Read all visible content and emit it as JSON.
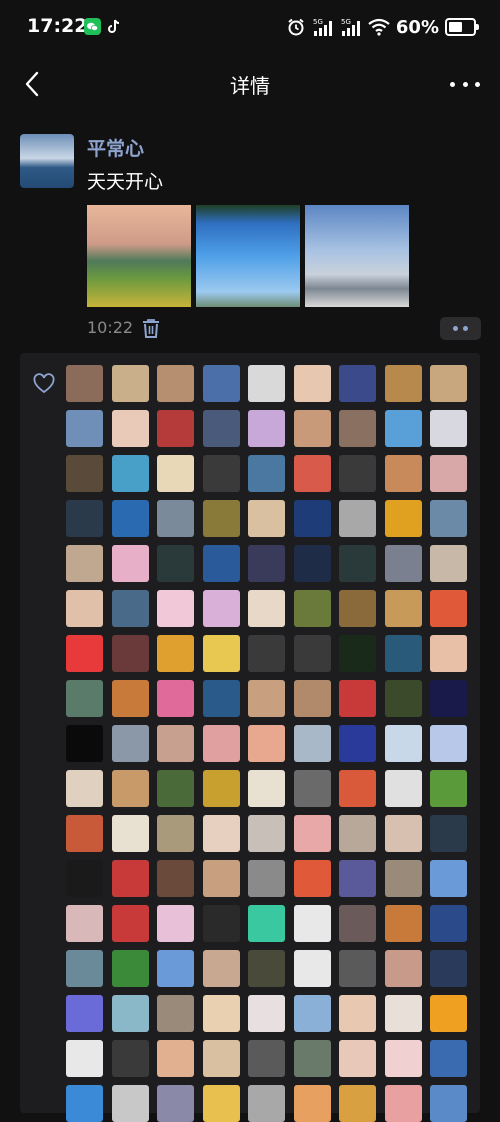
{
  "status_bar": {
    "time": "17:22",
    "battery": "60%",
    "battery_level": 0.6,
    "icons": [
      "wechat-icon",
      "tiktok-icon",
      "alarm-icon",
      "signal-5g-icon",
      "signal-5g-icon",
      "wifi-icon",
      "battery-icon"
    ]
  },
  "nav": {
    "title": "详情"
  },
  "post": {
    "author": "平常心",
    "text": "天天开心",
    "time": "10:22",
    "photos": [
      "flower-field-mountain-photo",
      "wind-turbine-sky-photo",
      "city-buildings-sky-photo"
    ]
  },
  "likes": {
    "icon": "heart-outline-icon",
    "avatar_colors": [
      "#8b6b5a",
      "#c9b08a",
      "#b58f6f",
      "#4b6fa8",
      "#d9d9d9",
      "#e7c7b0",
      "#3b4a8a",
      "#b8894d",
      "#c9a77e",
      "#6f8fb8",
      "#e9c9b7",
      "#b53a3a",
      "#4a5a7a",
      "#c8a8d8",
      "#c99a7a",
      "#8a7060",
      "#5aa0d8",
      "#d8d8e0",
      "#5a4a3a",
      "#48a0c8",
      "#e8d8b8",
      "#3a3a3a",
      "#4a78a0",
      "#d85a4a",
      "#3a3a3a",
      "#c88a5a",
      "#d8a8a8",
      "#2a3a4a",
      "#2a6ab0",
      "#7a8a9a",
      "#8a7a3a",
      "#d8c0a0",
      "#1e3c78",
      "#a8a8a8",
      "#e0a020",
      "#6a8aa8",
      "#c0a890",
      "#e8b0c8",
      "#2a3a3a",
      "#2a5a9a",
      "#3a3a5a",
      "#1e2c48",
      "#2a3a3a",
      "#7a8090",
      "#c8b8a8",
      "#e0c0a8",
      "#4a6a8a",
      "#f0c8d8",
      "#d8b0d8",
      "#e8d8c8",
      "#6a7a3a",
      "#8a6a3a",
      "#c89a5a",
      "#e05a3a",
      "#e83a3a",
      "#6a3a3a",
      "#e0a030",
      "#e8c850",
      "#3a3a3a",
      "#3a3a3a",
      "#1a2a1a",
      "#2a5a7a",
      "#e8c0a8",
      "#5a7a6a",
      "#c87a3a",
      "#e06a9a",
      "#2a5a8a",
      "#c8a080",
      "#b08a6a",
      "#c83a3a",
      "#3a4a2a",
      "#1a1a4a",
      "#0a0a0a",
      "#8a98a8",
      "#c8a090",
      "#e0a0a0",
      "#e8a890",
      "#a8b8c8",
      "#2a3a9a",
      "#c8d8e8",
      "#b8c8e8",
      "#e0d0c0",
      "#c89a6a",
      "#4a6a3a",
      "#c8a030",
      "#e8e0d0",
      "#6a6a6a",
      "#d85a3a",
      "#e0e0e0",
      "#5a9a3a",
      "#c85a3a",
      "#e8e0d0",
      "#a89a7a",
      "#e8d0c0",
      "#c8c0b8",
      "#e8a8a8",
      "#b8a89a",
      "#d8c0b0",
      "#2a3a4a",
      "#1a1a1a",
      "#c83a3a",
      "#6a4a3a",
      "#c8a080",
      "#8a8a8a",
      "#e05a3a",
      "#5a5a9a",
      "#9a8a7a",
      "#6a9ad8",
      "#d8b8b8",
      "#c83a3a",
      "#e8c0d8",
      "#2a2a2a",
      "#3ac8a0",
      "#e8e8e8",
      "#6a5a5a",
      "#c87a3a",
      "#2a4a8a",
      "#6a8a9a",
      "#3a8a3a",
      "#6a9ad8",
      "#c8a890",
      "#4a4a3a",
      "#e8e8e8",
      "#5a5a5a",
      "#c89a8a",
      "#2a3a5a",
      "#6a6ad8",
      "#8ab8c8",
      "#9a8a7a",
      "#e8d0b0",
      "#e8e0e0",
      "#8ab0d8",
      "#e8c8b0",
      "#e8e0d8",
      "#f0a020",
      "#e8e8e8",
      "#3a3a3a",
      "#e0b090",
      "#d8c0a0",
      "#5a5a5a",
      "#6a7a6a",
      "#e8c8b8",
      "#f0d0d0",
      "#3a6ab0",
      "#3a8ad8",
      "#c8c8c8",
      "#8a8aa8",
      "#e8c050",
      "#a8a8a8",
      "#e8a060",
      "#d8a040",
      "#e8a0a0",
      "#5a8ac8"
    ]
  }
}
